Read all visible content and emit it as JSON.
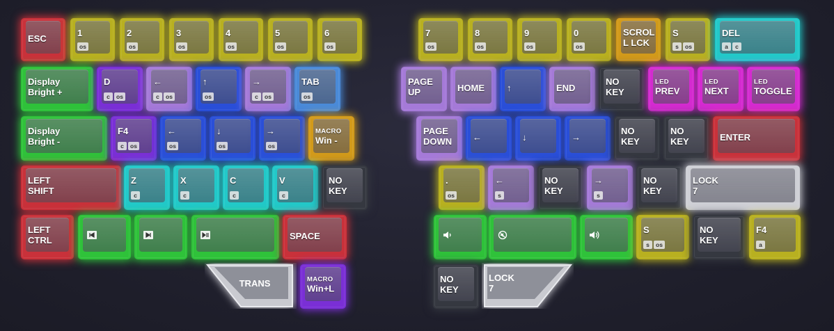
{
  "colors": {
    "red": "#c9313a",
    "yellow": "#b8b020",
    "green": "#2fc23a",
    "purple": "#7a2fd6",
    "lavender": "#a57ad8",
    "blue": "#2a4fd8",
    "steel": "#4a8ad8",
    "cyan": "#22c9c9",
    "orange": "#d29a1a",
    "magenta": "#d42bd0",
    "black": "#353840",
    "white": "#cfd0d6"
  },
  "keys": [
    {
      "id": "esc",
      "label": "ESC",
      "mods": [],
      "color": "red"
    },
    {
      "id": "k1",
      "label": "1",
      "mods": [
        "os"
      ],
      "color": "yellow"
    },
    {
      "id": "k2",
      "label": "2",
      "mods": [
        "os"
      ],
      "color": "yellow"
    },
    {
      "id": "k3",
      "label": "3",
      "mods": [
        "os"
      ],
      "color": "yellow"
    },
    {
      "id": "k4",
      "label": "4",
      "mods": [
        "os"
      ],
      "color": "yellow"
    },
    {
      "id": "k5",
      "label": "5",
      "mods": [
        "os"
      ],
      "color": "yellow"
    },
    {
      "id": "k6",
      "label": "6",
      "mods": [
        "os"
      ],
      "color": "yellow"
    },
    {
      "id": "k7",
      "label": "7",
      "mods": [
        "os"
      ],
      "color": "yellow"
    },
    {
      "id": "k8",
      "label": "8",
      "mods": [
        "os"
      ],
      "color": "yellow"
    },
    {
      "id": "k9",
      "label": "9",
      "mods": [
        "os"
      ],
      "color": "yellow"
    },
    {
      "id": "k0",
      "label": "0",
      "mods": [
        "os"
      ],
      "color": "yellow"
    },
    {
      "id": "scroll",
      "label": "SCROL\nL LCK",
      "mods": [],
      "color": "orange"
    },
    {
      "id": "s1",
      "label": "S",
      "mods": [
        "s",
        "os"
      ],
      "color": "yellow"
    },
    {
      "id": "del",
      "label": "DEL",
      "mods": [
        "a",
        "c"
      ],
      "color": "cyan"
    },
    {
      "id": "dbplus",
      "label": "Display\nBright +",
      "mods": [],
      "color": "green"
    },
    {
      "id": "d",
      "label": "D",
      "mods": [
        "c",
        "os"
      ],
      "color": "purple"
    },
    {
      "id": "larrow1",
      "label": "←",
      "mods": [
        "c",
        "os"
      ],
      "color": "lavender"
    },
    {
      "id": "uarrow1",
      "label": "↑",
      "mods": [
        "os"
      ],
      "color": "blue"
    },
    {
      "id": "rarrow1",
      "label": "→",
      "mods": [
        "c",
        "os"
      ],
      "color": "lavender"
    },
    {
      "id": "tab",
      "label": "TAB",
      "mods": [
        "os"
      ],
      "color": "steel"
    },
    {
      "id": "pgup",
      "label": "PAGE\nUP",
      "mods": [],
      "color": "lavender"
    },
    {
      "id": "home",
      "label": "HOME",
      "mods": [],
      "color": "lavender"
    },
    {
      "id": "uarrow2",
      "label": "↑",
      "mods": [],
      "color": "blue"
    },
    {
      "id": "end",
      "label": "END",
      "mods": [],
      "color": "lavender"
    },
    {
      "id": "nokey1",
      "label": "NO\nKEY",
      "mods": [],
      "color": "black"
    },
    {
      "id": "ledprev",
      "small": "LED",
      "label": "PREV",
      "mods": [],
      "color": "magenta"
    },
    {
      "id": "lednext",
      "small": "LED",
      "label": "NEXT",
      "mods": [],
      "color": "magenta"
    },
    {
      "id": "ledtog",
      "small": "LED",
      "label": "TOGGLE",
      "mods": [],
      "color": "magenta"
    },
    {
      "id": "dbminus",
      "label": "Display\nBright -",
      "mods": [],
      "color": "green"
    },
    {
      "id": "f4a",
      "label": "F4",
      "mods": [
        "c",
        "os"
      ],
      "color": "purple"
    },
    {
      "id": "larrow2",
      "label": "←",
      "mods": [
        "os"
      ],
      "color": "blue"
    },
    {
      "id": "darrow1",
      "label": "↓",
      "mods": [
        "os"
      ],
      "color": "blue"
    },
    {
      "id": "rarrow2",
      "label": "→",
      "mods": [
        "os"
      ],
      "color": "blue"
    },
    {
      "id": "macrowin",
      "small": "MACRO",
      "label": "Win -",
      "mods": [],
      "color": "orange"
    },
    {
      "id": "pgdn",
      "label": "PAGE\nDOWN",
      "mods": [],
      "color": "lavender"
    },
    {
      "id": "larrow3",
      "label": "←",
      "mods": [],
      "color": "blue"
    },
    {
      "id": "darrow2",
      "label": "↓",
      "mods": [],
      "color": "blue"
    },
    {
      "id": "rarrow3",
      "label": "→",
      "mods": [],
      "color": "blue"
    },
    {
      "id": "nokey2",
      "label": "NO\nKEY",
      "mods": [],
      "color": "black"
    },
    {
      "id": "nokey3",
      "label": "NO\nKEY",
      "mods": [],
      "color": "black"
    },
    {
      "id": "enter",
      "label": "ENTER",
      "mods": [],
      "color": "red"
    },
    {
      "id": "lshift",
      "label": "LEFT\nSHIFT",
      "mods": [],
      "color": "red"
    },
    {
      "id": "z",
      "label": "Z",
      "mods": [
        "c"
      ],
      "color": "cyan"
    },
    {
      "id": "x",
      "label": "X",
      "mods": [
        "c"
      ],
      "color": "cyan"
    },
    {
      "id": "c",
      "label": "C",
      "mods": [
        "c"
      ],
      "color": "cyan"
    },
    {
      "id": "v",
      "label": "V",
      "mods": [
        "c"
      ],
      "color": "cyan"
    },
    {
      "id": "nokey4",
      "label": "NO\nKEY",
      "mods": [],
      "color": "black"
    },
    {
      "id": "dot",
      "label": ".",
      "mods": [
        "os"
      ],
      "color": "yellow"
    },
    {
      "id": "larrow4",
      "label": "←",
      "mods": [
        "s"
      ],
      "color": "lavender"
    },
    {
      "id": "nokey5",
      "label": "NO\nKEY",
      "mods": [],
      "color": "black"
    },
    {
      "id": "rarrow4",
      "label": "→",
      "mods": [
        "s"
      ],
      "color": "lavender"
    },
    {
      "id": "nokey6",
      "label": "NO\nKEY",
      "mods": [],
      "color": "black"
    },
    {
      "id": "lock7a",
      "label": "LOCK\n7",
      "mods": [],
      "color": "white"
    },
    {
      "id": "lctrl",
      "label": "LEFT\nCTRL",
      "mods": [],
      "color": "red"
    },
    {
      "id": "prev",
      "icon": "prev-track-icon",
      "label": "",
      "mods": [],
      "color": "green"
    },
    {
      "id": "next",
      "icon": "next-track-icon",
      "label": "",
      "mods": [],
      "color": "green"
    },
    {
      "id": "play",
      "icon": "play-pause-icon",
      "label": "",
      "mods": [],
      "color": "green"
    },
    {
      "id": "space",
      "label": "SPACE",
      "mods": [],
      "color": "red"
    },
    {
      "id": "voldn",
      "icon": "volume-down-icon",
      "label": "",
      "mods": [],
      "color": "green"
    },
    {
      "id": "mute",
      "icon": "mute-icon",
      "label": "",
      "mods": [],
      "color": "green"
    },
    {
      "id": "volup",
      "icon": "volume-up-icon",
      "label": "",
      "mods": [],
      "color": "green"
    },
    {
      "id": "s2",
      "label": "S",
      "mods": [
        "s",
        "os"
      ],
      "color": "yellow"
    },
    {
      "id": "nokey7",
      "label": "NO\nKEY",
      "mods": [],
      "color": "black"
    },
    {
      "id": "f4b",
      "label": "F4",
      "mods": [
        "a"
      ],
      "color": "yellow"
    },
    {
      "id": "macrowinl",
      "small": "MACRO",
      "label": "Win+L",
      "mods": [],
      "color": "purple"
    },
    {
      "id": "nokey8",
      "label": "NO\nKEY",
      "mods": [],
      "color": "black"
    }
  ],
  "thumbs": {
    "trans": {
      "label": "TRANS",
      "color": "white"
    },
    "lock7b": {
      "label": "LOCK\n7",
      "color": "white"
    }
  }
}
